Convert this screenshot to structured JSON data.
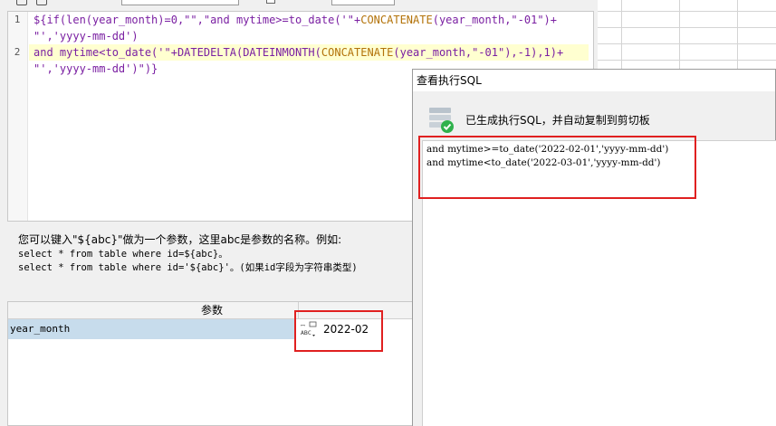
{
  "editor": {
    "line_numbers": [
      "1",
      "2"
    ],
    "line1a": [
      "${if(len(year_month)=0,\"\",\"and mytime>=to_date('\"+",
      "CONCATENATE",
      "(year_month,\"-01\")+"
    ],
    "line1b": "\"','yyyy-mm-dd')",
    "line2a": [
      "and mytime<to_date('\"+DATEDELTA(DATEINMONTH(",
      "CONCATENATE",
      "(year_month,\"-01\"),-1),1)+"
    ],
    "line2b": "\"','yyyy-mm-dd')\")}"
  },
  "hint": {
    "title": "您可以键入\"${abc}\"做为一个参数，这里abc是参数的名称。例如:",
    "example1": "select * from table where id=${abc}。",
    "example2": "select * from table where id='${abc}'。(如果id字段为字符串类型)"
  },
  "params": {
    "header": "参数",
    "rows": [
      {
        "name": "year_month",
        "value": "2022-02",
        "type_icon": "abc-type-icon"
      }
    ]
  },
  "dialog": {
    "title": "查看执行SQL",
    "message": "已生成执行SQL，并自动复制到剪切板",
    "sql_lines": [
      "and mytime>=to_date('2022-02-01','yyyy-mm-dd')",
      "and mytime<to_date('2022-03-01','yyyy-mm-dd')"
    ]
  },
  "colors": {
    "highlight": "#ffffd0",
    "selected_row": "#c7dcec",
    "annotation": "#e02020",
    "keyword": "#7a1fa2"
  }
}
